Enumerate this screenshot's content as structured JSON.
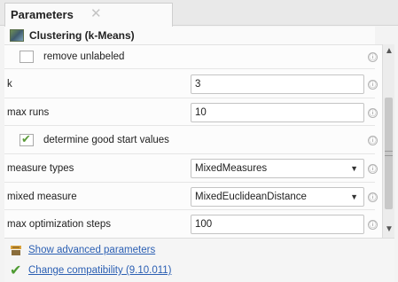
{
  "tab": {
    "title": "Parameters",
    "close_icon": "close-icon"
  },
  "operator": {
    "title": "Clustering (k-Means)",
    "icon": "clustering-icon"
  },
  "params": {
    "remove_unlabeled": {
      "label": "remove unlabeled",
      "checked": false
    },
    "k": {
      "label": "k",
      "value": "3"
    },
    "max_runs": {
      "label": "max runs",
      "value": "10"
    },
    "determine_good_start_values": {
      "label": "determine good start values",
      "checked": true
    },
    "measure_types": {
      "label": "measure types",
      "value": "MixedMeasures"
    },
    "mixed_measure": {
      "label": "mixed measure",
      "value": "MixedEuclideanDistance"
    },
    "max_optimization_steps": {
      "label": "max optimization steps",
      "value": "100"
    }
  },
  "info_glyph": "ⓘ",
  "footer": {
    "advanced_link": "Show advanced parameters",
    "compat_link": "Change compatibility (9.10.011)"
  },
  "colors": {
    "link": "#2b5fb3",
    "check": "#5b9b39"
  }
}
